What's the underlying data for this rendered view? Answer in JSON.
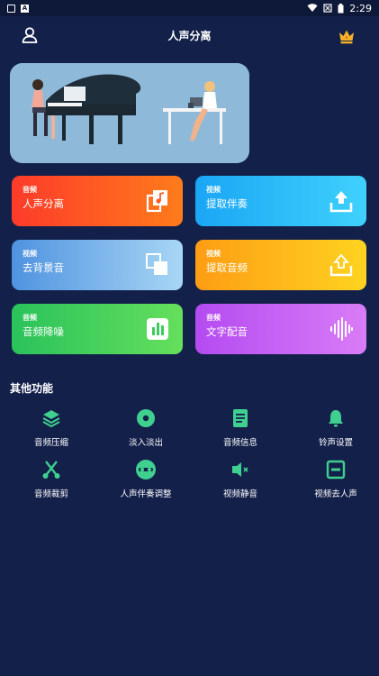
{
  "status_bar": {
    "time": "2:29"
  },
  "header": {
    "title": "人声分离"
  },
  "colors": {
    "background": "#13204a",
    "icon_green": "#3fcf8e",
    "vip_gold": "#f5b12a"
  },
  "cards": [
    {
      "tag": "音频",
      "name": "人声分离",
      "icon": "music-file-icon"
    },
    {
      "tag": "视频",
      "name": "提取伴奏",
      "icon": "upload-tray-icon"
    },
    {
      "tag": "视频",
      "name": "去背景音",
      "icon": "layers-square-icon"
    },
    {
      "tag": "视频",
      "name": "提取音频",
      "icon": "upload-tray-icon"
    },
    {
      "tag": "音频",
      "name": "音频降噪",
      "icon": "equalizer-icon"
    },
    {
      "tag": "音频",
      "name": "文字配音",
      "icon": "waveform-icon"
    }
  ],
  "other": {
    "title": "其他功能",
    "items": [
      {
        "label": "音频压缩",
        "icon": "layers-icon"
      },
      {
        "label": "淡入淡出",
        "icon": "disc-icon"
      },
      {
        "label": "音频信息",
        "icon": "document-icon"
      },
      {
        "label": "铃声设置",
        "icon": "bell-icon"
      },
      {
        "label": "音频裁剪",
        "icon": "scissors-icon"
      },
      {
        "label": "人声伴奏调整",
        "icon": "cassette-icon"
      },
      {
        "label": "视频静音",
        "icon": "speaker-mute-icon"
      },
      {
        "label": "视频去人声",
        "icon": "box-minus-icon"
      }
    ]
  }
}
